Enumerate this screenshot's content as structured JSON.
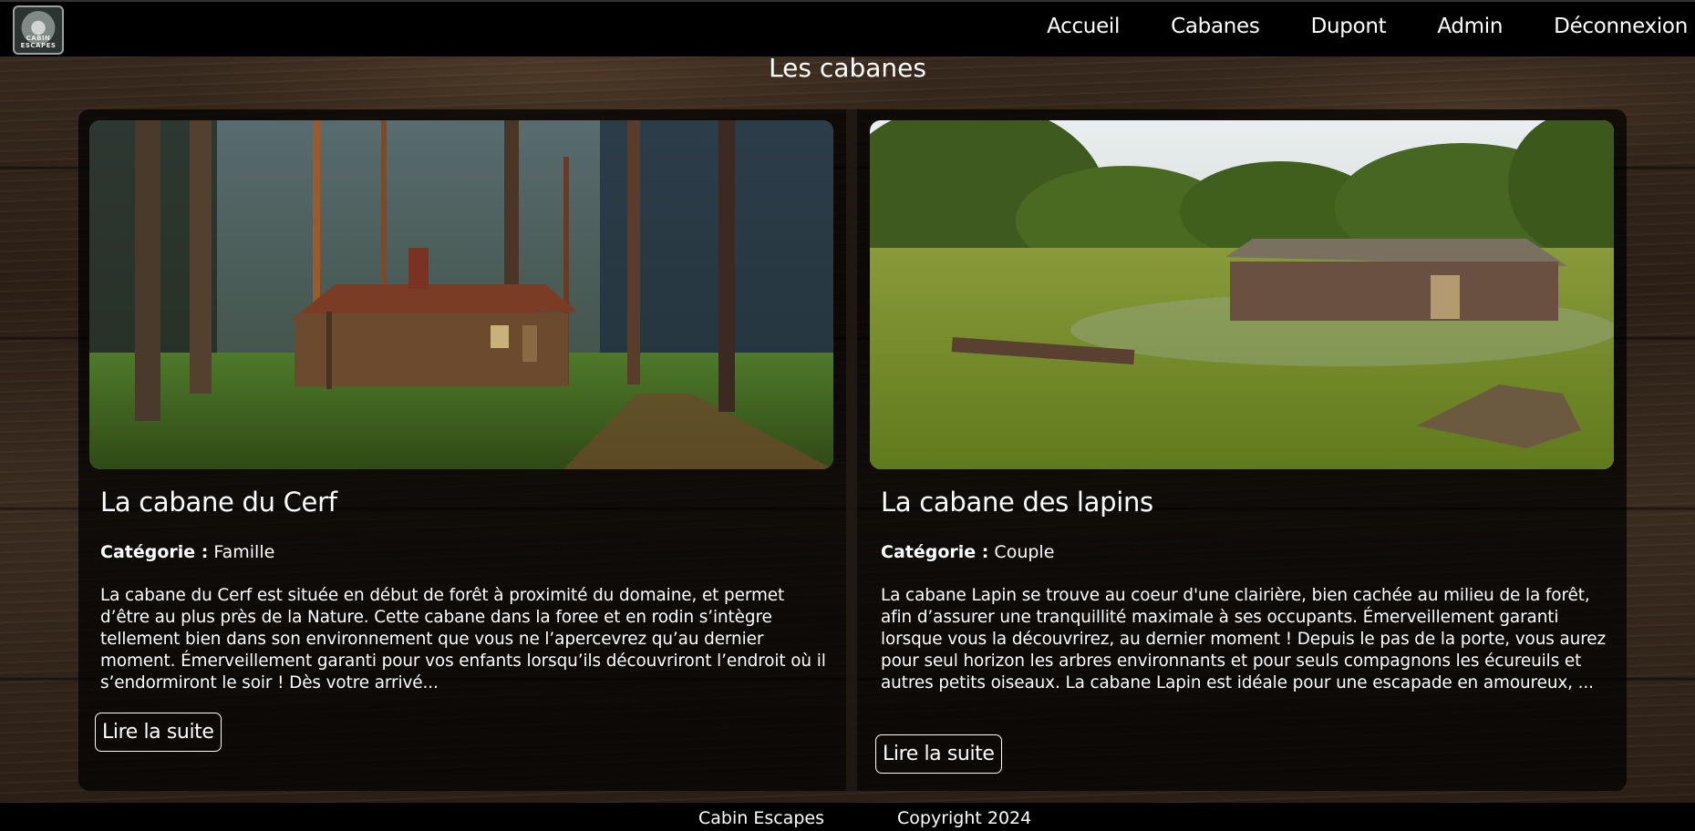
{
  "nav": {
    "logo_text": "CABIN ESCAPES",
    "links": [
      "Accueil",
      "Cabanes",
      "Dupont",
      "Admin",
      "Déconnexion"
    ]
  },
  "page": {
    "title": "Les cabanes"
  },
  "cards": [
    {
      "title": "La cabane du Cerf",
      "category_label": "Catégorie :",
      "category": "Famille",
      "description": "La cabane du Cerf est située en début de forêt à proximité du domaine, et permet d’être au plus près de la Nature. Cette cabane dans la foree et en rodin s’intègre tellement bien dans son environnement que vous ne l’apercevrez qu’au dernier moment. Émerveillement garanti pour vos enfants lorsqu’ils découvriront l’endroit où il s’endormiront le soir ! Dès votre arrivé...",
      "button": "Lire la suite",
      "image": "forest-cabin-photo"
    },
    {
      "title": "La cabane des lapins",
      "category_label": "Catégorie :",
      "category": "Couple",
      "description": "La cabane Lapin se trouve au coeur d'une clairière, bien cachée au milieu de  la forêt, afin d’assurer une tranquillité maximale à ses occupants. Émerveillement garanti lorsque vous la découvrirez, au dernier moment ! Depuis le pas de la porte, vous aurez pour seul horizon les arbres environnants et pour seuls compagnons les écureuils et autres petits oiseaux. La cabane Lapin est idéale pour une escapade en amoureux, ...",
      "button": "Lire la suite",
      "image": "meadow-cabin-photo"
    }
  ],
  "footer": {
    "brand": "Cabin Escapes",
    "copyright": "Copyright 2024"
  },
  "colors": {
    "nav_bg": "#000000",
    "text": "#ffffff",
    "wood": "#2b1f16"
  }
}
